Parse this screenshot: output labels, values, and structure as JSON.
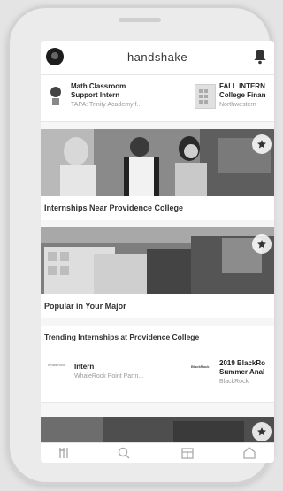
{
  "app": {
    "logo_text": "handshake"
  },
  "top_jobs": [
    {
      "title_line1": "Math Classroom",
      "title_line2": "Support Intern",
      "employer": "TAPA: Trinity Academy f..."
    },
    {
      "title_line1": "FALL INTERN",
      "title_line2": "College Finan",
      "employer": "Northwestern"
    }
  ],
  "sections": {
    "near": "Internships Near Providence College",
    "major": "Popular in Your Major",
    "trending": "Trending Internships at Providence College"
  },
  "trending_jobs": [
    {
      "logo_text": "WhaleRock",
      "title_line1": "Intern",
      "title_line2": "",
      "employer": "WhaleRock Point Partn..."
    },
    {
      "logo_text": "BlackRock",
      "title_line1": "2019 BlackRo",
      "title_line2": "Summer Anal",
      "employer": "BlackRock"
    }
  ],
  "icons": {
    "avatar": "profile-avatar",
    "bell": "bell-icon",
    "star": "star-icon",
    "nav": [
      "jobs-icon",
      "search-icon",
      "events-icon",
      "profile-icon"
    ]
  }
}
